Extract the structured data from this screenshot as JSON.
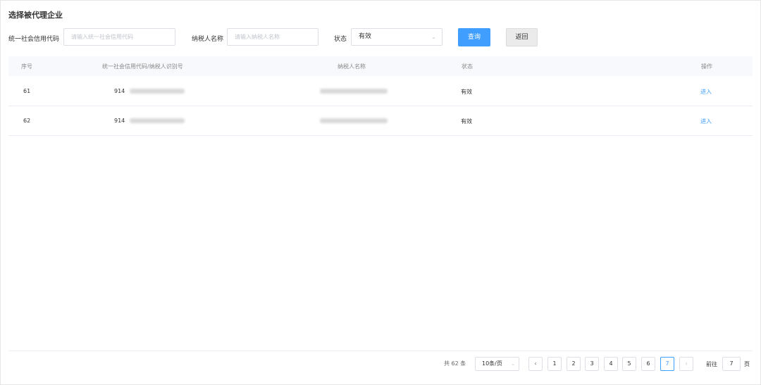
{
  "page_title": "选择被代理企业",
  "filters": {
    "credit_code_label": "统一社会信用代码",
    "credit_code_placeholder": "请输入统一社会信用代码",
    "taxpayer_name_label": "纳税人名称",
    "taxpayer_name_placeholder": "请输入纳税人名称",
    "status_label": "状态",
    "status_value": "有效",
    "query_button": "查询",
    "back_button": "返回"
  },
  "table": {
    "columns": [
      "序号",
      "统一社会信用代码/纳税人识别号",
      "纳税人名称",
      "状态",
      "操作"
    ],
    "rows": [
      {
        "index": "61",
        "code": "914",
        "name": "",
        "status": "有效",
        "action": "进入"
      },
      {
        "index": "62",
        "code": "914",
        "name": "",
        "status": "有效",
        "action": "进入"
      }
    ]
  },
  "pagination": {
    "total": "共 62 条",
    "page_size": "10条/页",
    "pages": [
      "1",
      "2",
      "3",
      "4",
      "5",
      "6",
      "7"
    ],
    "current_page": "7",
    "goto_prefix": "前往",
    "goto_value": "7",
    "goto_suffix": "页"
  },
  "colors": {
    "primary": "#409eff",
    "header_bg": "#f7f9fc"
  }
}
